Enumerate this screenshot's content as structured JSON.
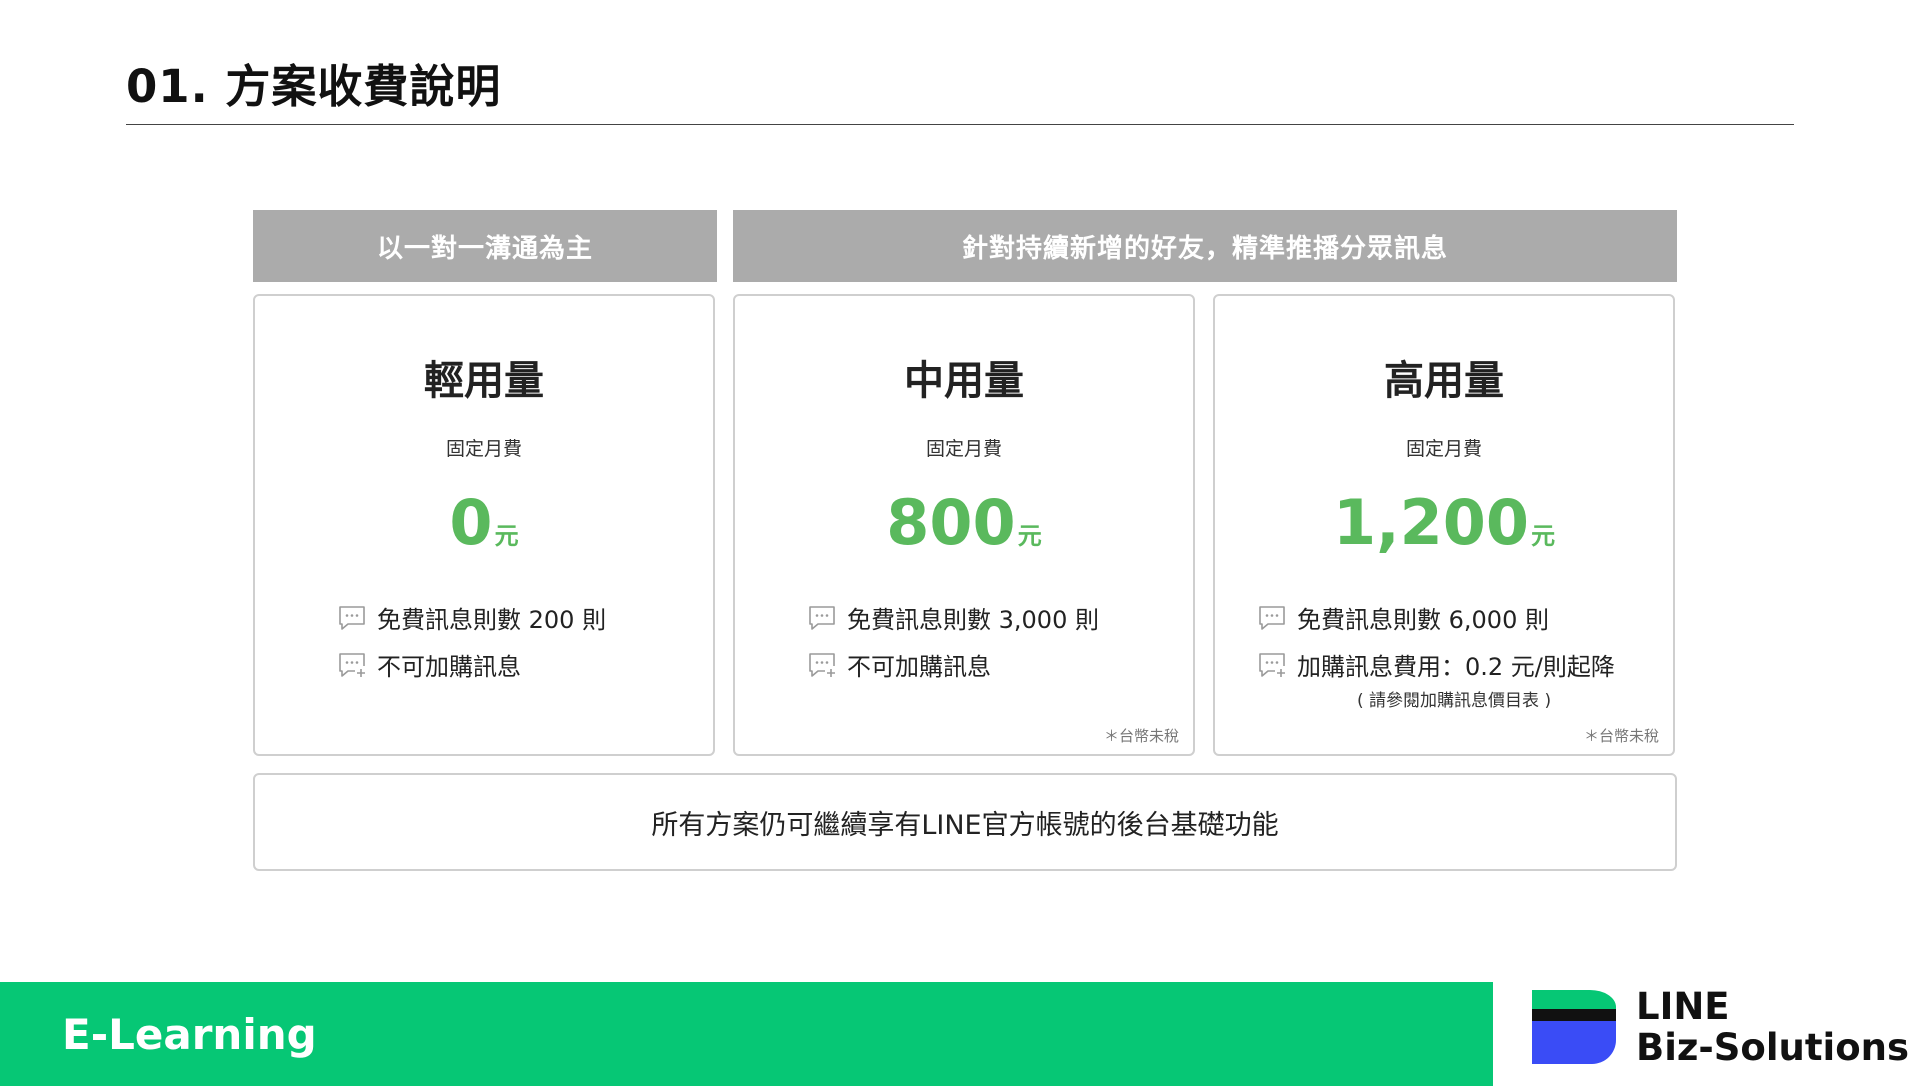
{
  "page": {
    "title": "01. 方案收費說明"
  },
  "categories": [
    "以一對一溝通為主",
    "針對持續新增的好友，精準推播分眾訊息"
  ],
  "plans": [
    {
      "name": "輕用量",
      "subtitle": "固定月費",
      "price": "0",
      "unit": "元",
      "features": [
        "免費訊息則數 200 則",
        "不可加購訊息"
      ],
      "note": "",
      "tax": ""
    },
    {
      "name": "中用量",
      "subtitle": "固定月費",
      "price": "800",
      "unit": "元",
      "features": [
        "免費訊息則數 3,000 則",
        "不可加購訊息"
      ],
      "note": "",
      "tax": "＊台幣未稅"
    },
    {
      "name": "高用量",
      "subtitle": "固定月費",
      "price": "1,200",
      "unit": "元",
      "features": [
        "免費訊息則數 6,000 則",
        "加購訊息費用：0.2 元/則起降"
      ],
      "note": "( 請參閱加購訊息價目表 )",
      "tax": "＊台幣未稅"
    }
  ],
  "footer_note": "所有方案仍可繼續享有LINE官方帳號的後台基礎功能",
  "bottom_band": {
    "label": "E-Learning"
  },
  "logo": {
    "line1": "LINE",
    "line2": "Biz-Solutions"
  },
  "colors": {
    "price_green": "#5ab95d",
    "band_green": "#06c775",
    "header_gray": "#ababab",
    "logo_blue": "#3a4cf6"
  },
  "icons": [
    "chat-bubble-icon",
    "chat-bubble-plus-icon"
  ]
}
